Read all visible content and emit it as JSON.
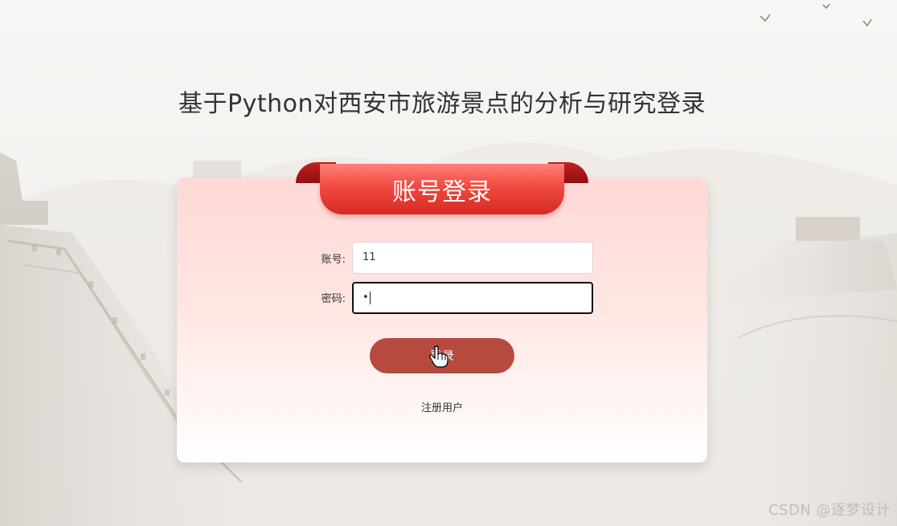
{
  "page": {
    "title": "基于Python对西安市旅游景点的分析与研究登录"
  },
  "login_card": {
    "header": "账号登录",
    "account": {
      "label": "账号:",
      "value": "11"
    },
    "password": {
      "label": "密码:",
      "masked_value": "•"
    },
    "login_button": "登录",
    "register_link": "注册用户"
  },
  "watermark": "CSDN @逐梦设计",
  "colors": {
    "ribbon": "#e8392f",
    "login_button": "#b74a3f",
    "card_top": "#ffd9d6"
  },
  "icons": {
    "cursor": "hand-pointer-icon",
    "birds": "flying-bird-icon"
  }
}
